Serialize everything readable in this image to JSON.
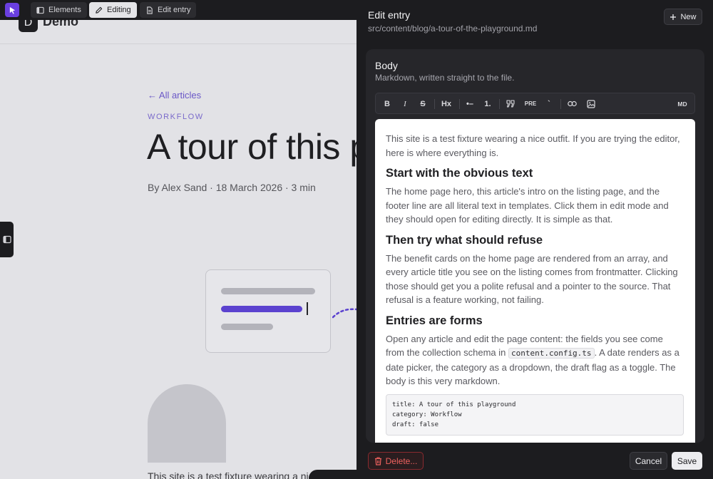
{
  "toolbar": {
    "elements_label": "Elements",
    "editing_label": "Editing",
    "edit_entry_label": "Edit entry"
  },
  "site": {
    "logo_letter": "D",
    "logo_text": "Demo",
    "back_link": "← All articles",
    "category": "WORKFLOW",
    "title": "A tour of this playground",
    "byline": "By Alex Sand · 18 March 2026 · 3 min",
    "body_start": "This site is a test fixture wearing a nice outfit."
  },
  "panel": {
    "title": "Edit entry",
    "path": "src/content/blog/a-tour-of-the-playground.md",
    "new_label": "New",
    "field": {
      "label": "Body",
      "help": "Markdown, written straight to the file."
    },
    "md_toolbar": {
      "bold": "B",
      "italic": "I",
      "strike": "S",
      "heading": "Hx",
      "bullet_list": "•–",
      "ordered_list": "1.",
      "pre": "PRE",
      "inline_code": "`",
      "md": "MD"
    },
    "editor": {
      "p1": "This site is a test fixture wearing a nice outfit. If you are trying the editor, here is where everything is.",
      "h1": "Start with the obvious text",
      "p2": "The home page hero, this article's intro on the listing page, and the footer line are all literal text in templates. Click them in edit mode and they should open for editing directly. It is simple as that.",
      "h2": "Then try what should refuse",
      "p3": "The benefit cards on the home page are rendered from an array, and every article title you see on the listing comes from frontmatter. Clicking those should get you a polite refusal and a pointer to the source. That refusal is a feature working, not failing.",
      "h3": "Entries are forms",
      "p4_before": "Open any article and edit the page content: the fields you see come from the collection schema in ",
      "p4_code": "content.config.ts",
      "p4_after": ". A date renders as a date picker, the category as a dropdown, the draft flag as a toggle. The body is this very markdown.",
      "code_block": "title: A tour of this playground\ncategory: Workflow\ndraft: false"
    },
    "delete_label": "Delete...",
    "cancel_label": "Cancel",
    "save_label": "Save"
  },
  "colors": {
    "accent": "#6a3fe0",
    "danger": "#f0625f",
    "panel_bg": "#1c1c1f"
  }
}
